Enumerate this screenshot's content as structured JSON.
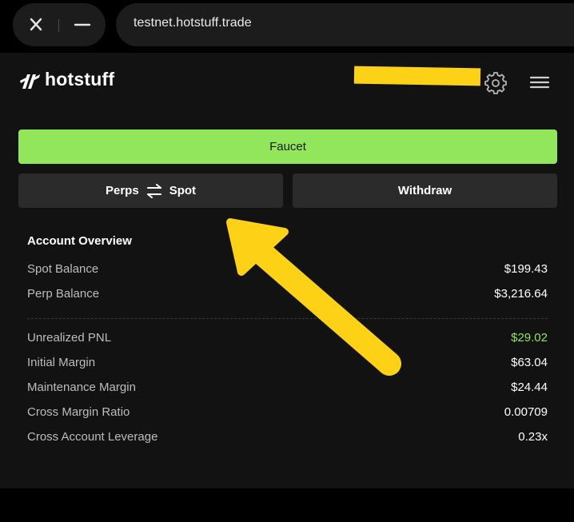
{
  "browser": {
    "url": "testnet.hotstuff.trade"
  },
  "header": {
    "brand": "hotstuff"
  },
  "actions": {
    "faucet_label": "Faucet",
    "transfer_from": "Perps",
    "transfer_to": "Spot",
    "withdraw_label": "Withdraw"
  },
  "account": {
    "title": "Account Overview",
    "balances": [
      {
        "label": "Spot Balance",
        "value": "$199.43"
      },
      {
        "label": "Perp Balance",
        "value": "$3,216.64"
      }
    ],
    "metrics": [
      {
        "label": "Unrealized PNL",
        "value": "$29.02"
      },
      {
        "label": "Initial Margin",
        "value": "$63.04"
      },
      {
        "label": "Maintenance Margin",
        "value": "$24.44"
      },
      {
        "label": "Cross Margin Ratio",
        "value": "0.00709"
      },
      {
        "label": "Cross Account Leverage",
        "value": "0.23x"
      }
    ]
  },
  "colors": {
    "accent_green": "#92e65c",
    "annotation_yellow": "#fdd116",
    "panel_bg": "#121212",
    "button_bg": "#2b2b2b"
  },
  "icons": [
    "close-icon",
    "minimize-icon",
    "logo-icon",
    "gear-icon",
    "hamburger-menu-icon",
    "swap-arrows-icon"
  ]
}
